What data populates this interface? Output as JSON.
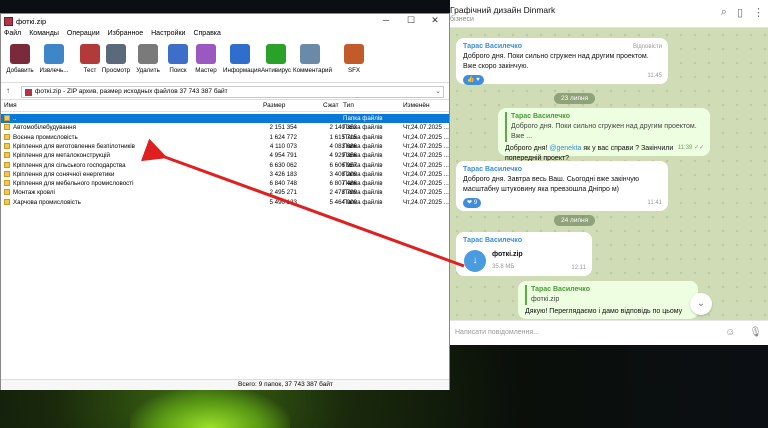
{
  "telegram": {
    "title": "Графічний дизайн Dinmark",
    "subtitle": "бізнеси",
    "messages": [
      {
        "sender": "Тарас Василечко",
        "side_label": "Відповісти",
        "text": "Доброго дня. Поки сильно сгружен над другим проектом. Вже скоро закінчую.",
        "time": "11:45",
        "reaction": "👍 ♥"
      },
      {
        "date": "23 липня"
      },
      {
        "quote_name": "Тарас Василечко",
        "quote_text": "Доброго дня. Поки сильно сгружен над другим проектом. Вже ...",
        "text_pre": "Доброго дня! ",
        "mention": "@genekta",
        "text_post": " як у вас справи ? Закінчили попередній проект?",
        "time": "11:39 ✓✓"
      },
      {
        "sender": "Тарас Василечко",
        "text": "Доброго дня. Завтра весь Ваш. Сьогодні вже закінчую масштабну штуковину яка превзошла Дніпро м)",
        "time": "11:41",
        "reaction": "❤ 9"
      },
      {
        "date": "24 липня"
      },
      {
        "sender": "Тарас Василечко",
        "file_name": "фоткі.zip",
        "file_size": "35.8 МБ",
        "time": "12:11"
      },
      {
        "quote_name": "Тарас Василечко",
        "quote_text": "фоткі.zip",
        "text": "Дякую! Переглядаємо і дамо відповідь по цьому",
        "time": "12:08"
      }
    ],
    "input_placeholder": "Написати повідомлення..."
  },
  "rar": {
    "title": "фоткі.zip",
    "menu": [
      "Файл",
      "Команды",
      "Операции",
      "Избранное",
      "Настройки",
      "Справка"
    ],
    "toolbar": [
      {
        "label": "Добавить",
        "icon": "add-icon",
        "color": "#7a2a3a"
      },
      {
        "label": "Извлечь...",
        "icon": "extract-icon",
        "color": "#3f86c9"
      },
      {
        "label": "Тест",
        "icon": "test-icon",
        "color": "#b33a3a"
      },
      {
        "label": "Просмотр",
        "icon": "view-icon",
        "color": "#5a6a7a"
      },
      {
        "label": "Удалить",
        "icon": "delete-icon",
        "color": "#7a7a7a"
      },
      {
        "label": "Поиск",
        "icon": "search-icon",
        "color": "#3f6ec9"
      },
      {
        "label": "Мастер",
        "icon": "wizard-icon",
        "color": "#9a58c0"
      },
      {
        "label": "Информация",
        "icon": "info-icon",
        "color": "#2f6ecc"
      },
      {
        "label": "Антивирус",
        "icon": "antivirus-icon",
        "color": "#2aa22a"
      },
      {
        "label": "Комментарий",
        "icon": "comment-icon",
        "color": "#6a8aaa"
      },
      {
        "label": "SFX",
        "icon": "sfx-icon",
        "color": "#c25a2a"
      }
    ],
    "path": "фоткі.zip - ZIP архив, размер исходных файлов 37 743 387 байт",
    "columns": {
      "name": "Имя",
      "size": "Размер",
      "packed": "Сжат",
      "type": "Тип",
      "modified": "Изменён"
    },
    "rows": [
      {
        "name": "..",
        "size": "",
        "packed": "",
        "type": "Папка файлів",
        "modified": ""
      },
      {
        "name": "Автомобілебудування",
        "size": "2 151 354",
        "packed": "2 140 353",
        "type": "Папка файлів",
        "modified": "Чт,24.07.2025 ..."
      },
      {
        "name": "Воєнна промисловість",
        "size": "1 624 772",
        "packed": "1 615 715",
        "type": "Папка файлів",
        "modified": "Чт,24.07.2025 ..."
      },
      {
        "name": "Кріплення для виготовлення безпілотників",
        "size": "4 110 073",
        "packed": "4 083 686",
        "type": "Папка файлів",
        "modified": "Чт,24.07.2025 ..."
      },
      {
        "name": "Кріплення для металоконструкцій",
        "size": "4 954 791",
        "packed": "4 929 356",
        "type": "Папка файлів",
        "modified": "Чт,24.07.2025 ..."
      },
      {
        "name": "Кріплення для сільського господарства",
        "size": "6 630 062",
        "packed": "6 606 957",
        "type": "Папка файлів",
        "modified": "Чт,24.07.2025 ..."
      },
      {
        "name": "Кріплення для сонячної енергетики",
        "size": "3 426 183",
        "packed": "3 408 209",
        "type": "Папка файлів",
        "modified": "Чт,24.07.2025 ..."
      },
      {
        "name": "Кріплення для мебельного промисловості",
        "size": "6 840 748",
        "packed": "6 807 486",
        "type": "Папка файлів",
        "modified": "Чт,24.07.2025 ..."
      },
      {
        "name": "Монтаж кровлі",
        "size": "2 495 271",
        "packed": "2 478 799",
        "type": "Папка файлів",
        "modified": "Чт,24.07.2025 ..."
      },
      {
        "name": "Харчова промисловість",
        "size": "5 490 133",
        "packed": "5 464 000",
        "type": "Папка файлів",
        "modified": "Чт,24.07.2025 ..."
      }
    ],
    "status": "Всего: 9 папок, 37 743 387 байт"
  }
}
